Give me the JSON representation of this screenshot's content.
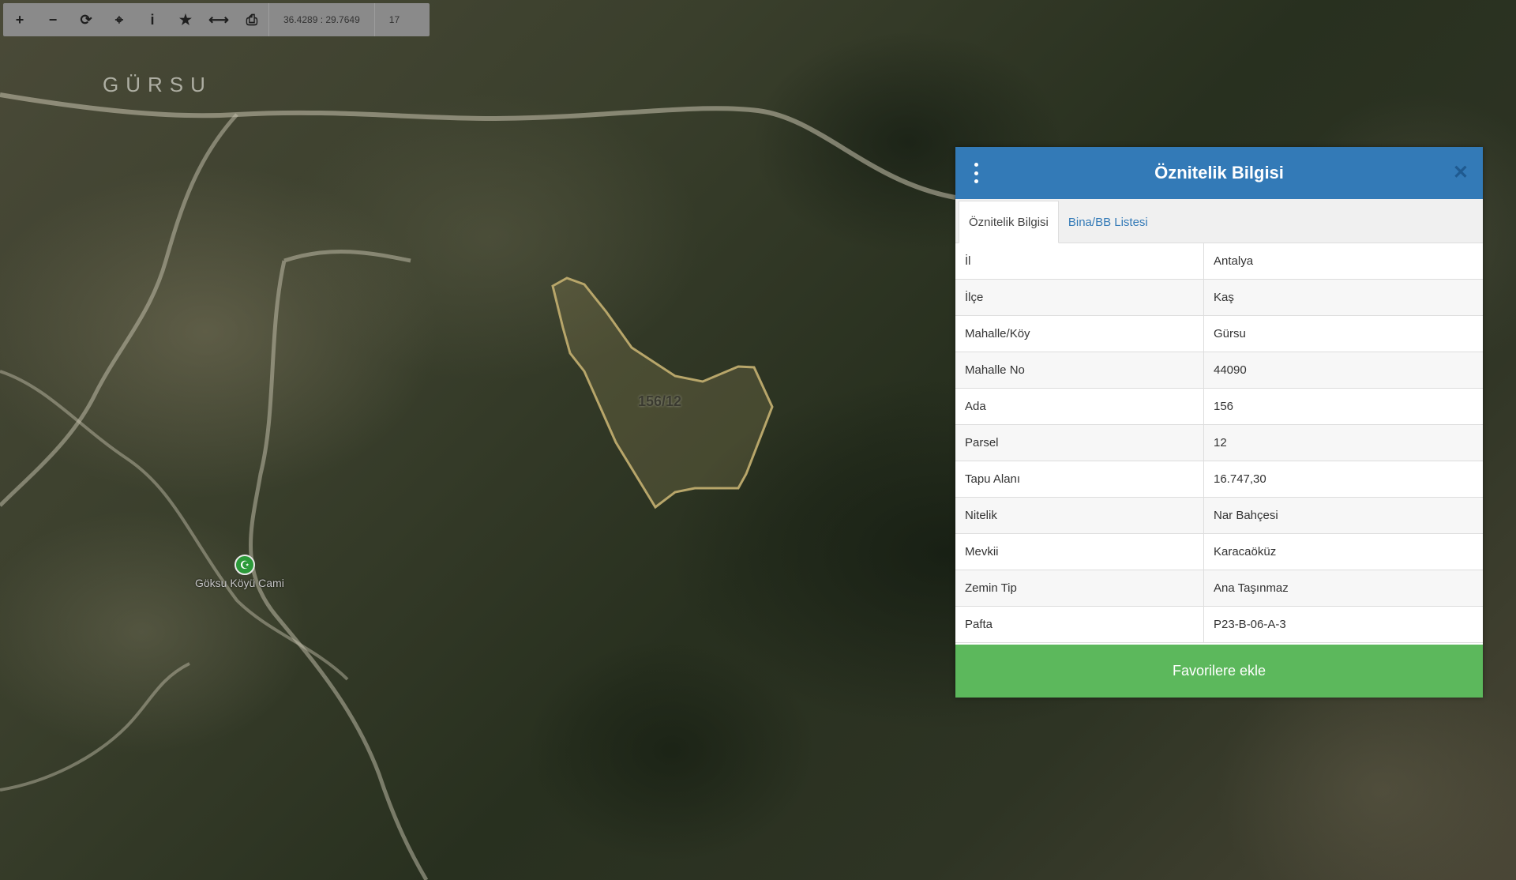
{
  "toolbar": {
    "buttons": [
      {
        "name": "zoom-in-button",
        "icon": "plus-icon",
        "glyph": "+"
      },
      {
        "name": "zoom-out-button",
        "icon": "minus-icon",
        "glyph": "−"
      },
      {
        "name": "refresh-button",
        "icon": "refresh-icon",
        "glyph": "⟳"
      },
      {
        "name": "locate-button",
        "icon": "crosshair-icon",
        "glyph": "⌖"
      },
      {
        "name": "info-button",
        "icon": "info-icon",
        "glyph": "i"
      },
      {
        "name": "favorite-button",
        "icon": "star-icon",
        "glyph": "★"
      },
      {
        "name": "measure-button",
        "icon": "measure-icon",
        "glyph": "⟷"
      },
      {
        "name": "print-button",
        "icon": "print-icon",
        "glyph": "⎙"
      }
    ],
    "coordinates": "36.4289 : 29.7649",
    "zoom": "17"
  },
  "map": {
    "place_label": "GÜRSU",
    "poi_label": "Göksu Köyü Cami",
    "poi_icon": "mosque-icon",
    "parcel_label": "156/12"
  },
  "panel": {
    "title": "Öznitelik Bilgisi",
    "tabs": [
      {
        "label": "Öznitelik Bilgisi",
        "active": true
      },
      {
        "label": "Bina/BB Listesi",
        "active": false
      }
    ],
    "rows": [
      {
        "key": "İl",
        "value": "Antalya"
      },
      {
        "key": "İlçe",
        "value": "Kaş"
      },
      {
        "key": "Mahalle/Köy",
        "value": "Gürsu"
      },
      {
        "key": "Mahalle No",
        "value": "44090"
      },
      {
        "key": "Ada",
        "value": "156"
      },
      {
        "key": "Parsel",
        "value": "12"
      },
      {
        "key": "Tapu Alanı",
        "value": "16.747,30"
      },
      {
        "key": "Nitelik",
        "value": "Nar Bahçesi"
      },
      {
        "key": "Mevkii",
        "value": "Karacaöküz"
      },
      {
        "key": "Zemin Tip",
        "value": "Ana Taşınmaz"
      },
      {
        "key": "Pafta",
        "value": "P23-B-06-A-3"
      }
    ],
    "favorite_button": "Favorilere ekle"
  },
  "colors": {
    "header": "#337ab7",
    "favorite": "#5cb85c",
    "parcel_outline": "#b8a66a"
  }
}
